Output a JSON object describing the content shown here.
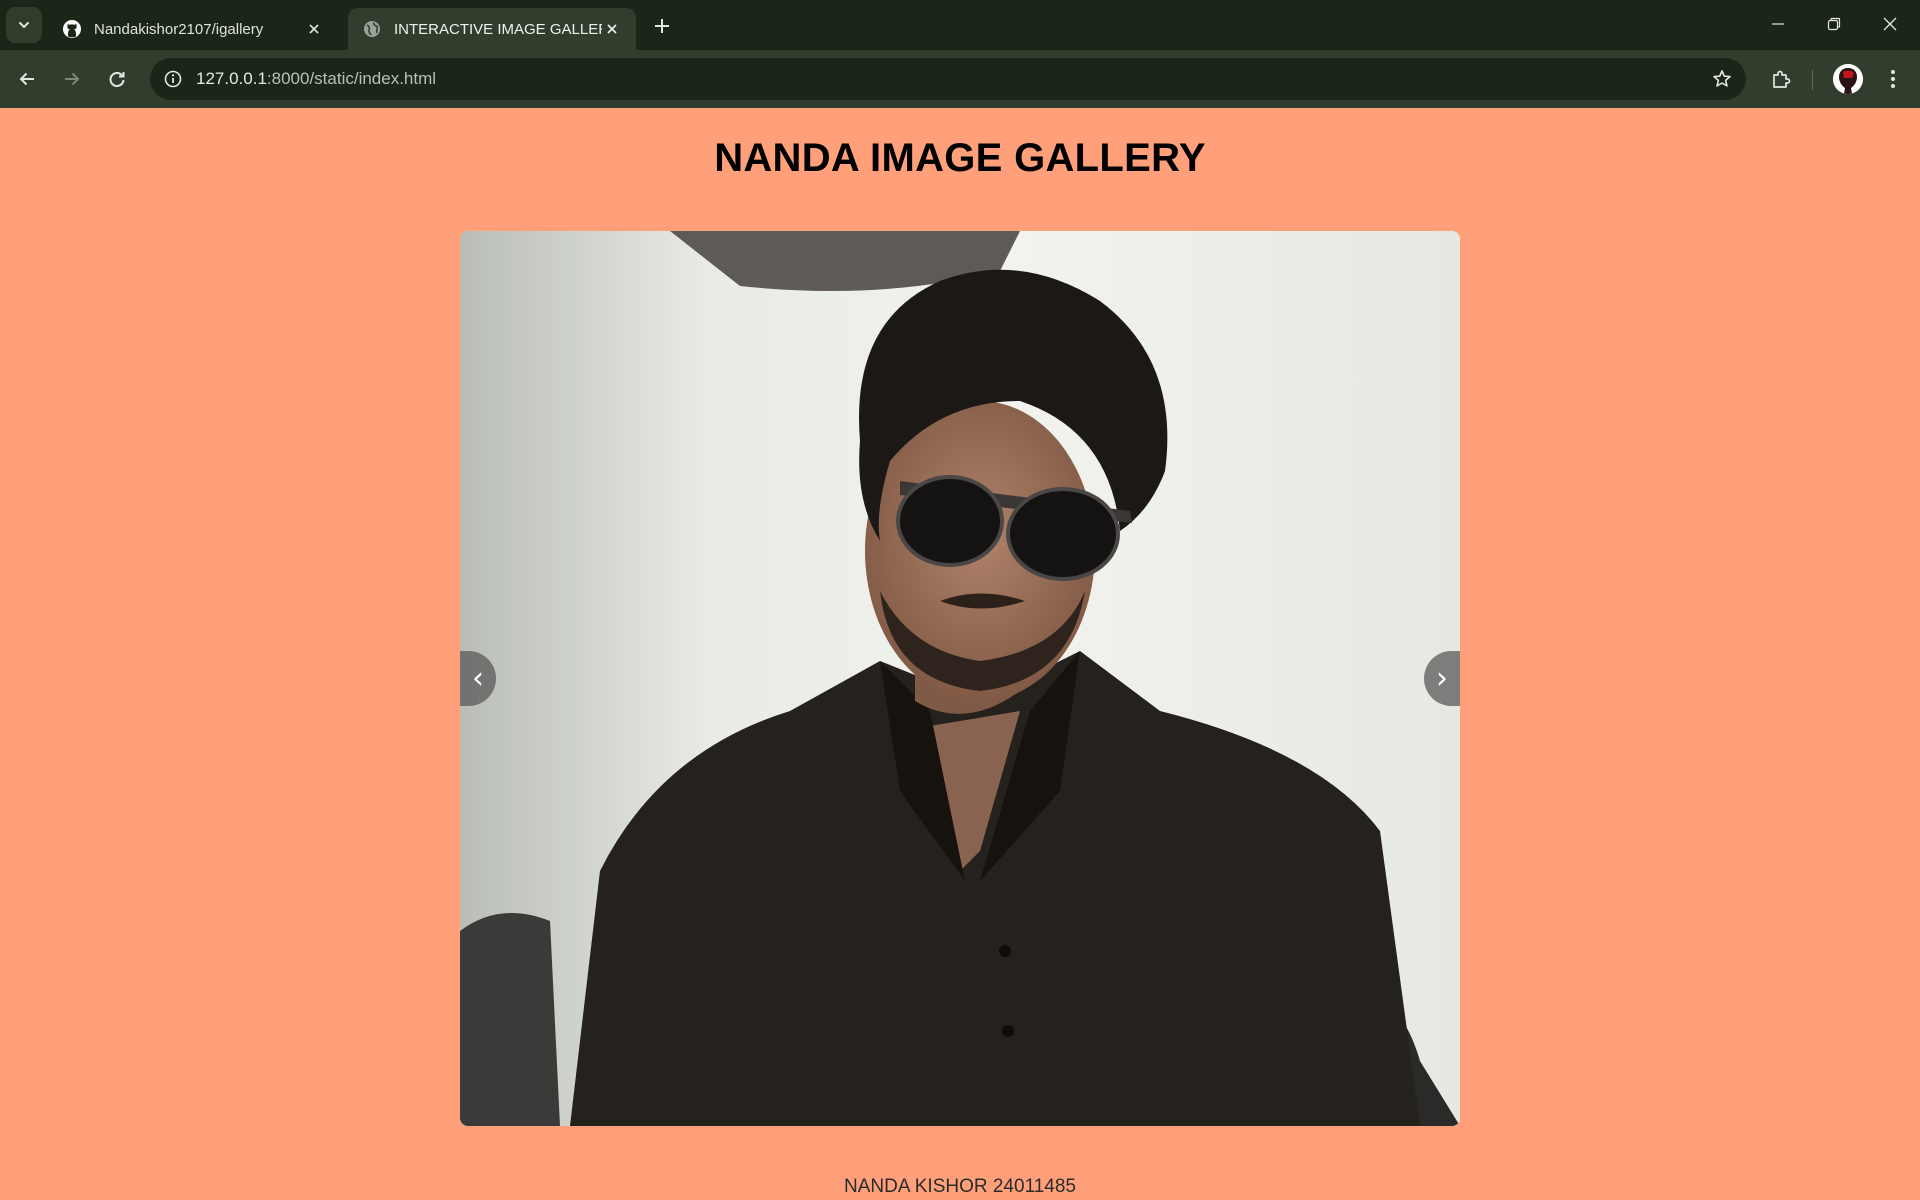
{
  "browser": {
    "tabs": [
      {
        "title": "Nandakishor2107/igallery",
        "icon": "github-icon",
        "active": false
      },
      {
        "title": "INTERACTIVE IMAGE GALLERY",
        "icon": "globe-icon",
        "active": true
      }
    ],
    "address_bar": {
      "url_host": "127.0.0.1",
      "url_rest": ":8000/static/index.html"
    },
    "colors": {
      "tabbar_bg": "#1c2618",
      "toolbar_bg": "#323e2d"
    }
  },
  "page": {
    "title": "NANDA IMAGE GALLERY",
    "background": "#ffa07a",
    "gallery": {
      "prev_label": "‹",
      "next_label": "›"
    },
    "footer": "NANDA KISHOR 24011485"
  }
}
